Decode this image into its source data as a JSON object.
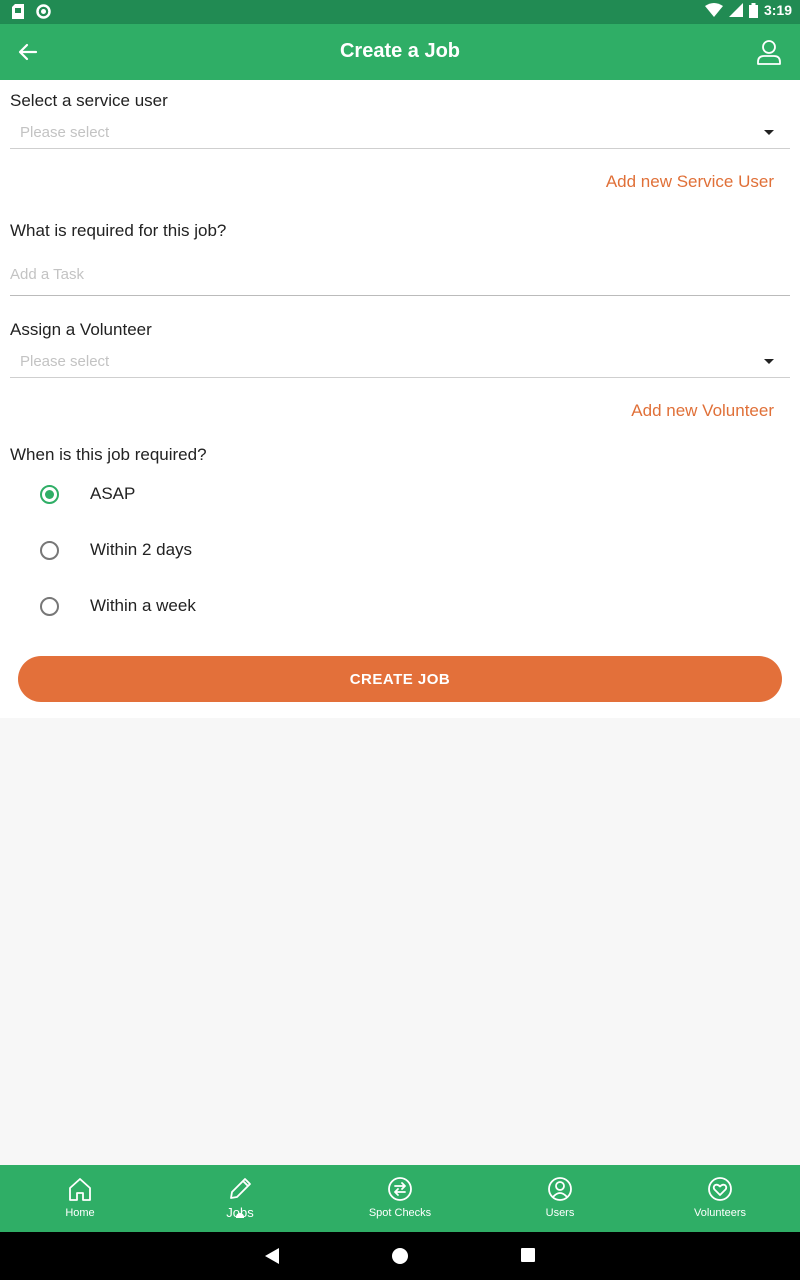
{
  "status_bar": {
    "time": "3:19"
  },
  "app_bar": {
    "title": "Create a Job"
  },
  "form": {
    "service_user": {
      "label": "Select a service user",
      "placeholder": "Please select",
      "add_link": "Add new Service User"
    },
    "task": {
      "label": "What is required for this job?",
      "placeholder": "Add a Task"
    },
    "volunteer": {
      "label": "Assign a Volunteer",
      "placeholder": "Please select",
      "add_link": "Add new Volunteer"
    },
    "timing": {
      "label": "When is this job required?",
      "options": [
        {
          "label": "ASAP",
          "selected": true
        },
        {
          "label": "Within 2 days",
          "selected": false
        },
        {
          "label": "Within a week",
          "selected": false
        }
      ]
    },
    "submit_label": "CREATE JOB"
  },
  "bottom_nav": {
    "items": [
      {
        "label": "Home",
        "icon": "home-icon"
      },
      {
        "label": "Jobs",
        "icon": "pencil-icon",
        "active": true
      },
      {
        "label": "Spot Checks",
        "icon": "swap-icon"
      },
      {
        "label": "Users",
        "icon": "user-circle-icon"
      },
      {
        "label": "Volunteers",
        "icon": "heart-circle-icon"
      }
    ]
  },
  "colors": {
    "primary": "#2fae66",
    "status_bar": "#218b53",
    "accent": "#e3703a",
    "link": "#e07038"
  }
}
